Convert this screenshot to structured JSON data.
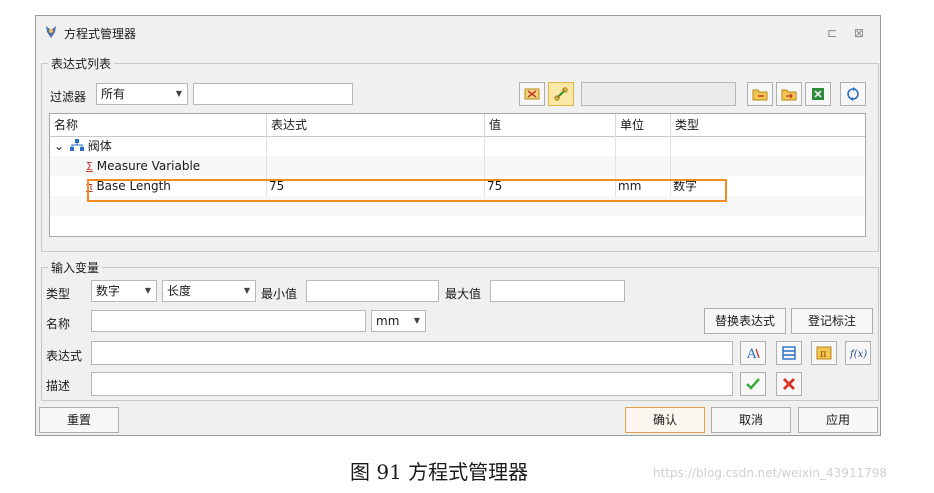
{
  "window": {
    "title": "方程式管理器",
    "pin_glyph": "⊏",
    "close_glyph": "⊠"
  },
  "expr_list": {
    "group_label": "表达式列表",
    "filter_label": "过滤器",
    "filter_value": "所有",
    "filter_text": "",
    "search_text": "",
    "columns": [
      "名称",
      "表达式",
      "值",
      "单位",
      "类型"
    ],
    "tree": {
      "parent": "阀体",
      "rows": [
        {
          "name": "Measure Variable",
          "expr": "",
          "value": "",
          "unit": "",
          "type": ""
        },
        {
          "name": "Base Length",
          "expr": "75",
          "value": "75",
          "unit": "mm",
          "type": "数字"
        }
      ]
    }
  },
  "input_var": {
    "group_label": "输入变量",
    "type_label": "类型",
    "type_value": "数字",
    "dimension_value": "长度",
    "min_label": "最小值",
    "min_value": "",
    "max_label": "最大值",
    "max_value": "",
    "name_label": "名称",
    "name_value": "",
    "unit_value": "mm",
    "replace_btn": "替换表达式",
    "register_btn": "登记标注",
    "expr_label": "表达式",
    "expr_value": "",
    "desc_label": "描述",
    "desc_value": ""
  },
  "footer": {
    "reset": "重置",
    "ok": "确认",
    "cancel": "取消",
    "apply": "应用"
  },
  "caption": "图 91   方程式管理器",
  "watermark": "https://blog.csdn.net/weixin_43911798",
  "colors": {
    "highlight": "#f08c1e",
    "check": "#3aa83a",
    "cross": "#d9342b"
  }
}
